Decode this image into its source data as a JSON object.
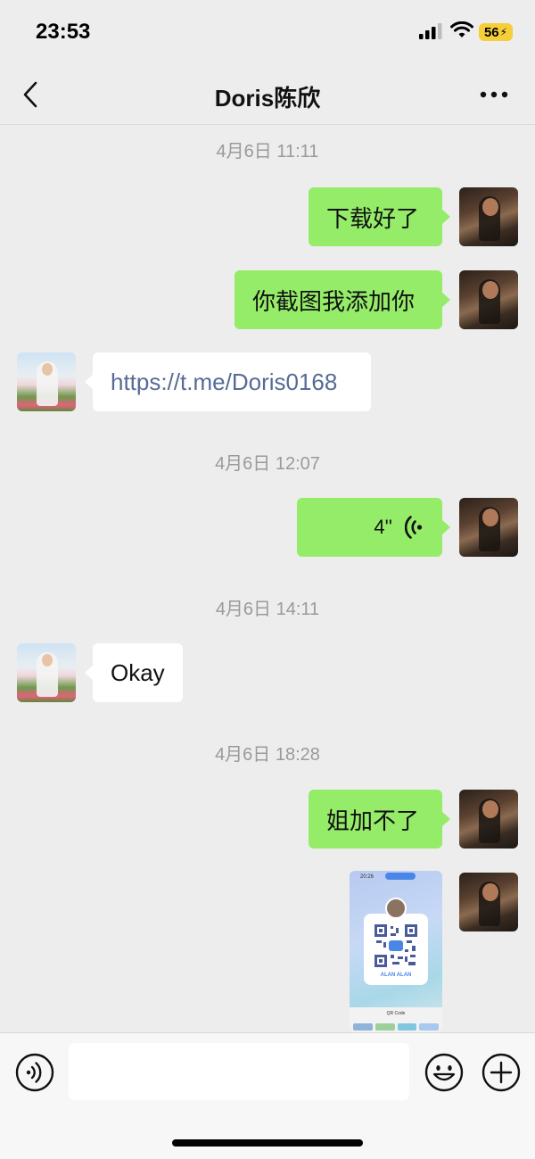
{
  "status_bar": {
    "time": "23:53",
    "battery": "56"
  },
  "header": {
    "title": "Doris陈欣"
  },
  "messages": [
    {
      "type": "timestamp",
      "text": "4月6日 11:11"
    },
    {
      "type": "text",
      "sender": "me",
      "text": "下载好了"
    },
    {
      "type": "text",
      "sender": "me",
      "text": "你截图我添加你"
    },
    {
      "type": "text",
      "sender": "them",
      "text": "https://t.me/Doris0168"
    },
    {
      "type": "timestamp",
      "text": "4月6日 12:07"
    },
    {
      "type": "voice",
      "sender": "me",
      "duration": "4''"
    },
    {
      "type": "timestamp",
      "text": "4月6日 14:11"
    },
    {
      "type": "text",
      "sender": "them",
      "text": "Okay"
    },
    {
      "type": "timestamp",
      "text": "4月6日 18:28"
    },
    {
      "type": "text",
      "sender": "me",
      "text": "姐加不了"
    },
    {
      "type": "image",
      "sender": "me",
      "thumb_time": "20:26",
      "thumb_name": "ALAN ALAN",
      "thumb_label": "QR Code"
    }
  ],
  "icons": {
    "back": "chevron-left-icon",
    "more": "more-horizontal-icon",
    "voice_toggle": "voice-mode-icon",
    "emoji": "emoji-icon",
    "plus": "plus-icon",
    "voice_wave": "voice-wave-icon"
  },
  "colors": {
    "background": "#EDEDED",
    "bubble_me": "#95EC69",
    "bubble_them": "#FFFFFF",
    "link": "#576B95",
    "timestamp": "#9A9A9A",
    "battery": "#F5CE3A"
  }
}
